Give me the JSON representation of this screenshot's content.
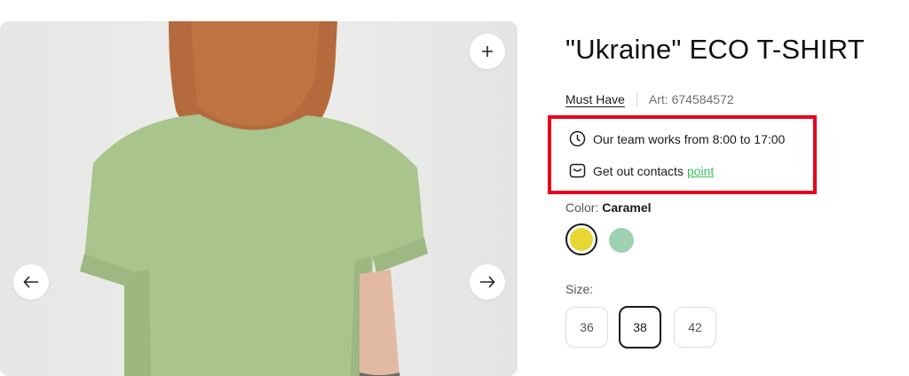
{
  "product": {
    "title": "\"Ukraine\" ECO T-SHIRT",
    "brand": "Must Have",
    "article": "Art: 674584572"
  },
  "notice": {
    "hours": "Our team works from 8:00 to 17:00",
    "contacts_text": "Get out contacts",
    "contacts_link": "point",
    "icons": [
      "clock-icon",
      "message-icon"
    ]
  },
  "color": {
    "label": "Color:",
    "selected": "Caramel",
    "swatches": [
      {
        "hex": "#e6d732",
        "selected": true
      },
      {
        "hex": "#9ed1b2",
        "selected": false
      }
    ]
  },
  "size": {
    "label": "Size:",
    "options": [
      "36",
      "38",
      "42"
    ],
    "selected": "38"
  },
  "gallery": {
    "buttons": [
      "zoom-plus-icon",
      "arrow-left-icon",
      "arrow-right-icon"
    ]
  },
  "colors": {
    "accent_red": "#e8001c",
    "link_green": "#3cbf5e"
  }
}
